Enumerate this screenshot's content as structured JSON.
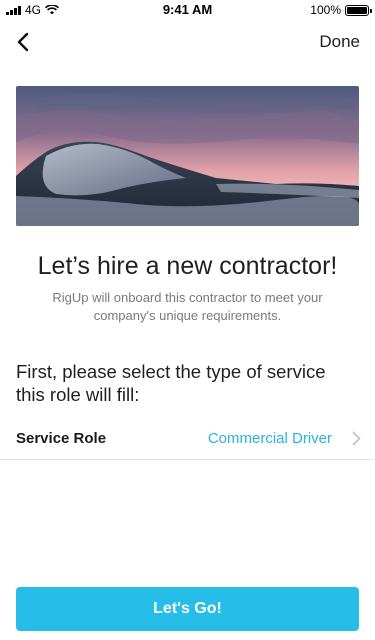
{
  "status_bar": {
    "carrier": "4G",
    "time": "9:41 AM",
    "battery": "100%",
    "battery_level": 1.0
  },
  "nav": {
    "back_icon": "chevron-left-icon",
    "done_label": "Done"
  },
  "hero": {
    "image": "mountain-sunset-landscape"
  },
  "content": {
    "title": "Let’s hire a new contractor!",
    "subtitle": "RigUp will onboard this contractor to meet your company's unique requirements.",
    "prompt": "First, please select the type of service this role will fill:"
  },
  "service_role": {
    "label": "Service Role",
    "value": "Commercial Driver",
    "chevron_icon": "chevron-right-icon"
  },
  "cta": {
    "label": "Let's Go!"
  },
  "colors": {
    "accent": "#26bde8",
    "value_text": "#2ab3de"
  }
}
